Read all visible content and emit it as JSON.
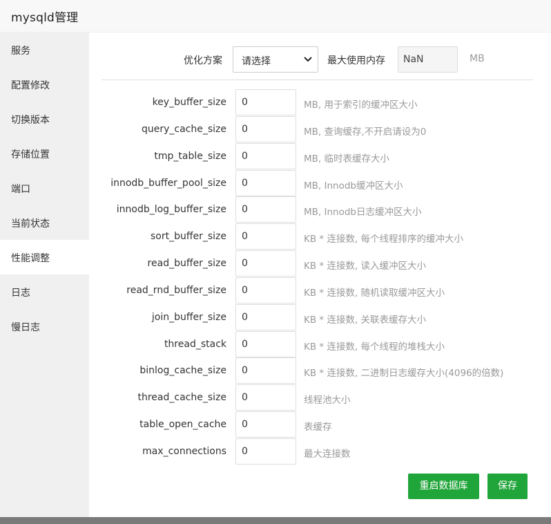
{
  "dialog": {
    "title": "mysqld管理"
  },
  "sidebar": {
    "items": [
      {
        "label": "服务",
        "name": "sidebar-item-service"
      },
      {
        "label": "配置修改",
        "name": "sidebar-item-config"
      },
      {
        "label": "切换版本",
        "name": "sidebar-item-version"
      },
      {
        "label": "存储位置",
        "name": "sidebar-item-storage"
      },
      {
        "label": "端口",
        "name": "sidebar-item-port"
      },
      {
        "label": "当前状态",
        "name": "sidebar-item-status"
      },
      {
        "label": "性能调整",
        "name": "sidebar-item-performance",
        "active": true
      },
      {
        "label": "日志",
        "name": "sidebar-item-log"
      },
      {
        "label": "慢日志",
        "name": "sidebar-item-slow-log"
      }
    ]
  },
  "optimize": {
    "label": "优化方案",
    "select_value": "请选择",
    "max_memory_label": "最大使用内存",
    "max_memory_value": "NaN",
    "max_memory_unit": "MB"
  },
  "params": [
    {
      "label": "key_buffer_size",
      "value": "0",
      "hint": "MB, 用于索引的缓冲区大小"
    },
    {
      "label": "query_cache_size",
      "value": "0",
      "hint": "MB, 查询缓存,不开启请设为0"
    },
    {
      "label": "tmp_table_size",
      "value": "0",
      "hint": "MB, 临时表缓存大小"
    },
    {
      "label": "innodb_buffer_pool_size",
      "value": "0",
      "hint": "MB, Innodb缓冲区大小"
    },
    {
      "label": "innodb_log_buffer_size",
      "value": "0",
      "hint": "MB, Innodb日志缓冲区大小"
    },
    {
      "label": "sort_buffer_size",
      "value": "0",
      "hint": "KB * 连接数, 每个线程排序的缓冲大小"
    },
    {
      "label": "read_buffer_size",
      "value": "0",
      "hint": "KB * 连接数, 读入缓冲区大小"
    },
    {
      "label": "read_rnd_buffer_size",
      "value": "0",
      "hint": "KB * 连接数, 随机读取缓冲区大小"
    },
    {
      "label": "join_buffer_size",
      "value": "0",
      "hint": "KB * 连接数, 关联表缓存大小"
    },
    {
      "label": "thread_stack",
      "value": "0",
      "hint": "KB * 连接数, 每个线程的堆栈大小"
    },
    {
      "label": "binlog_cache_size",
      "value": "0",
      "hint": "KB * 连接数, 二进制日志缓存大小(4096的倍数)"
    },
    {
      "label": "thread_cache_size",
      "value": "0",
      "hint": "线程池大小"
    },
    {
      "label": "table_open_cache",
      "value": "0",
      "hint": "表缓存"
    },
    {
      "label": "max_connections",
      "value": "0",
      "hint": "最大连接数"
    }
  ],
  "buttons": {
    "restart_label": "重启数据库",
    "save_label": "保存"
  },
  "colors": {
    "accent": "#20a53a",
    "sidebar_bg": "#f0f0f0",
    "hint_text": "#999999"
  }
}
